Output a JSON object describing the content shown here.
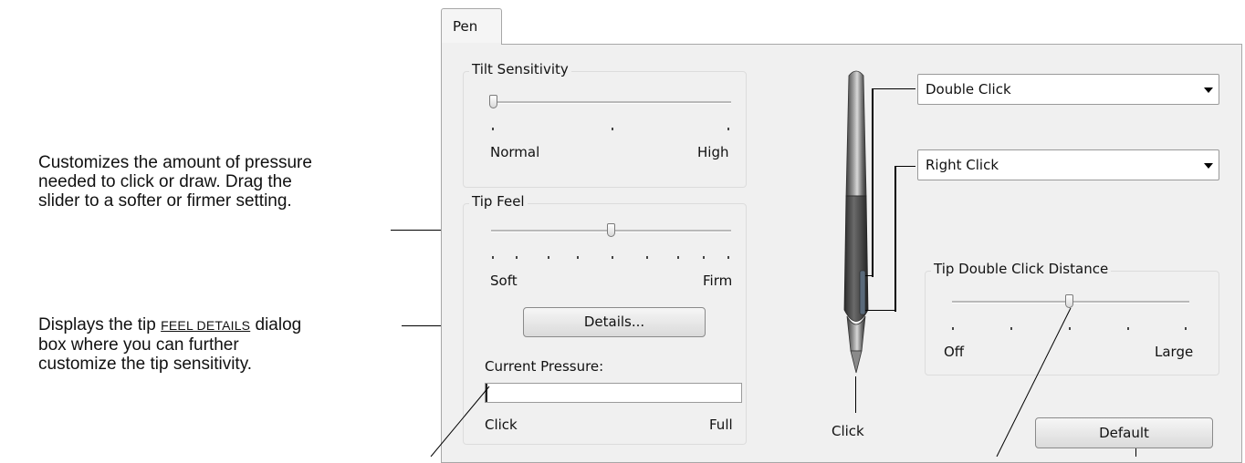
{
  "callouts": {
    "tip_feel": [
      "Customizes the amount of pressure",
      "needed to click or draw.  Drag the",
      "slider to a softer or firmer setting."
    ],
    "details_pre": "Displays the tip ",
    "details_link": "Feel Details",
    "details_post": " dialog",
    "details_lines": [
      "box where you can further",
      "customize the tip sensitivity."
    ]
  },
  "tab": {
    "label": "Pen"
  },
  "tilt": {
    "title": "Tilt Sensitivity",
    "min_label": "Normal",
    "max_label": "High",
    "value_fraction": 0.0
  },
  "tip_feel": {
    "title": "Tip Feel",
    "min_label": "Soft",
    "max_label": "Firm",
    "value_fraction": 0.5
  },
  "details_button": {
    "label": "Details..."
  },
  "pressure": {
    "title": "Current Pressure:",
    "min_label": "Click",
    "max_label": "Full",
    "value_fraction": 0.0
  },
  "pen": {
    "tip_label": "Click"
  },
  "upper_button": {
    "selected": "Double Click"
  },
  "lower_button": {
    "selected": "Right Click"
  },
  "double_click_distance": {
    "title": "Tip Double Click Distance",
    "min_label": "Off",
    "max_label": "Large",
    "value_fraction": 0.5
  },
  "default_button": {
    "label": "Default"
  }
}
